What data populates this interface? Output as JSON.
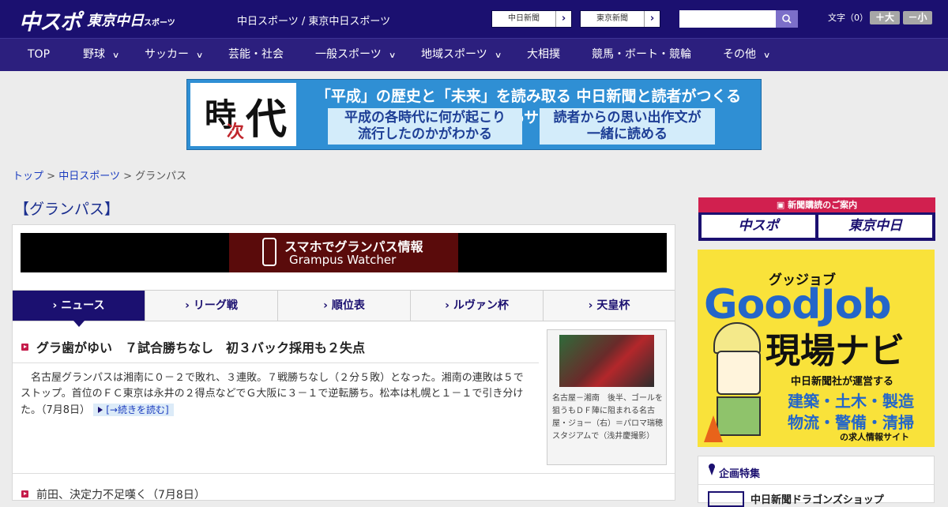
{
  "header": {
    "logo_chuspo": "中スポ",
    "logo_tokyo": "東京中日",
    "logo_tokyo_suffix": "スポーツ",
    "site_title": "中日スポーツ / 東京中日スポーツ",
    "ext_links": [
      "中日新聞",
      "東京新聞"
    ],
    "search_placeholder": "",
    "font_label": "文字（0）",
    "font_up": "＋大",
    "font_down": "－小"
  },
  "nav": {
    "items": [
      {
        "label": "TOP",
        "dropdown": false
      },
      {
        "label": "野球",
        "dropdown": true
      },
      {
        "label": "サッカー",
        "dropdown": true
      },
      {
        "label": "芸能・社会",
        "dropdown": false
      },
      {
        "label": "一般スポーツ",
        "dropdown": true
      },
      {
        "label": "地域スポーツ",
        "dropdown": true
      },
      {
        "label": "大相撲",
        "dropdown": false
      },
      {
        "label": "競馬・ボート・競輪",
        "dropdown": false
      },
      {
        "label": "その他",
        "dropdown": true
      }
    ]
  },
  "banner": {
    "chars": [
      "時",
      "次",
      "代"
    ],
    "headline": "「平成」の歴史と「未来」を読み取る 中日新聞と読者がつくるWebサイト",
    "box1": [
      "平成の各時代に何が起こり",
      "流行したのかがわかる"
    ],
    "box2": [
      "読者からの思い出作文が",
      "一緒に読める"
    ]
  },
  "breadcrumb": {
    "items": [
      "トップ",
      "中日スポーツ"
    ],
    "current": "グランパス",
    "separator": ">"
  },
  "page": {
    "title": "【グランパス】"
  },
  "grampus_banner": {
    "line1": "スマホでグランパス情報",
    "line2": "Grampus Watcher"
  },
  "tabs": [
    {
      "label": "ニュース",
      "active": true
    },
    {
      "label": "リーグ戦",
      "active": false
    },
    {
      "label": "順位表",
      "active": false
    },
    {
      "label": "ルヴァン杯",
      "active": false
    },
    {
      "label": "天皇杯",
      "active": false
    }
  ],
  "article": {
    "headline": "グラ歯がゆい　７試合勝ちなし　初３バック採用も２失点",
    "body": "　名古屋グランパスは湘南に０－２で敗れ、３連敗。７戦勝ちなし（２分５敗）となった。湘南の連敗は５でストップ。首位のＦＣ東京は永井の２得点などでＧ大阪に３－１で逆転勝ち。松本は札幌と１－１で引き分けた。",
    "date": "（7月8日）",
    "readmore": "[→続きを読む]",
    "photo_caption": "名古屋－湘南　後半、ゴールを狙うもＤＦ陣に阻まれる名古屋・ジョー（右）＝パロマ瑞穂スタジアムで（浅井慶撮影）"
  },
  "article2": {
    "headline": "前田、決定力不足嘆く（7月8日）"
  },
  "sidebar": {
    "subscribe_head": "新聞購読のご案内",
    "subscribe_boxes": [
      "中スポ",
      "東京中日"
    ],
    "ad": {
      "sub": "グッジョブ",
      "big": "GoodJob",
      "navi": "現場ナビ",
      "line1": "中日新聞社が運営する",
      "line2": "建築・土木・製造",
      "line3": "物流・警備・清掃",
      "line4": "の求人情報サイト"
    },
    "feature_title": "企画特集",
    "feature_item": "中日新聞ドラゴンズショップ"
  },
  "colors": {
    "header_bg": "#1b1070",
    "nav_bg": "#2c1f7e",
    "accent_red": "#c51b4a",
    "link_blue": "#1b3cbf",
    "ad_yellow": "#f9e23a"
  }
}
